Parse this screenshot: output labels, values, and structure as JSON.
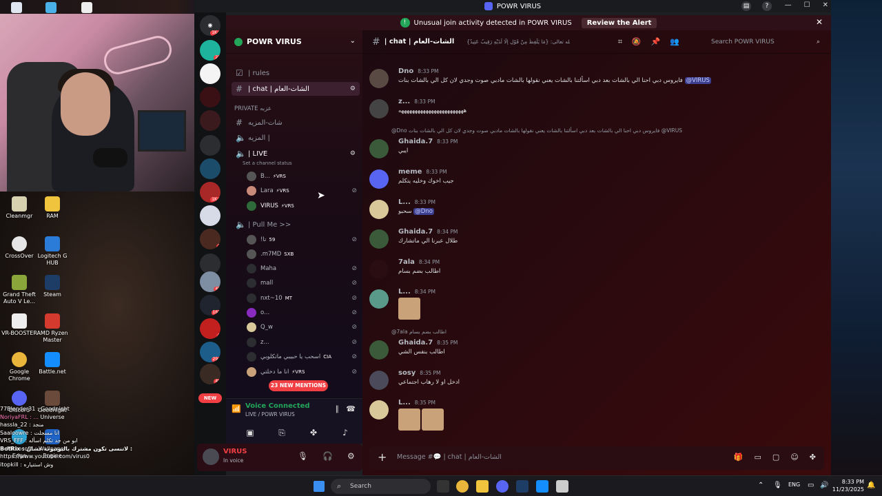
{
  "window": {
    "title": "POWR VIRUS"
  },
  "alert": {
    "text": "Unusual join activity detected in POWR VIRUS",
    "button": "Review the Alert"
  },
  "server": {
    "name": "POWR VIRUS"
  },
  "guild_badges": [
    "1K+",
    "23",
    "1K+",
    "3",
    "49",
    "162",
    "7",
    "294",
    "46"
  ],
  "guild_new": "NEW",
  "channels": {
    "rules": "| rules",
    "chat": "| chat | الشات-العام",
    "private_cat": "PRIVATE عزبه",
    "text_private": "شات-المزيه",
    "voice_private": "المزيه |",
    "live": "| LIVE",
    "live_status": "Set a channel status",
    "pull_me": "| Pull Me >>"
  },
  "voice_users_live": [
    {
      "name": "B...",
      "tag": "⚡VRS"
    },
    {
      "name": "Lara",
      "tag": "⚡VRS"
    },
    {
      "name": "VIRUS",
      "tag": "⚡VRS"
    }
  ],
  "voice_users_pull": [
    {
      "name": "!تا",
      "tag": "59"
    },
    {
      "name": ".m7MD",
      "tag": "SXB"
    },
    {
      "name": "Maha",
      "tag": ""
    },
    {
      "name": "mall",
      "tag": ""
    },
    {
      "name": "nxt~10",
      "tag": "MT"
    },
    {
      "name": "o...",
      "tag": ""
    },
    {
      "name": "Q_w",
      "tag": ""
    },
    {
      "name": "z...",
      "tag": ""
    },
    {
      "name": "اسحب يا حبيبي ماتكلوبي",
      "tag": "CIA"
    },
    {
      "name": "انا ما دخلتي",
      "tag": "⚡VRS"
    }
  ],
  "new_mentions": "23 NEW MENTIONS",
  "voice_panel": {
    "status": "Voice Connected",
    "location": "LIVE / POWR VIRUS"
  },
  "user_panel": {
    "name": "VIRUS",
    "status": "In voice"
  },
  "channel_header": {
    "name": "| chat | الشات-العام",
    "topic": "قال الله تعالى: {مَا يَلْفِظُ مِنْ قَوْلٍ إِلَّا لَدَيْهِ رَقِيبٌ عَتِيدٌ}",
    "search": "Search POWR VIRUS"
  },
  "messages": [
    {
      "name": "Dno",
      "time": "8:33 PM",
      "text": "فايروس دبي احنا الي بالشات بعد دبي اسألتنا بالشات يعني نقولها بالشات مادبي صوت وجدي لان كل الي بالشات بنات",
      "mention": "@VIRUS"
    },
    {
      "name": "z...",
      "time": "8:33 PM",
      "text": "ههههههههههههههههههههههههه"
    },
    {
      "reply": "@Dno فايروس دبي احنا الي بالشات بعد دبي اسألتنا بالشات يعني نقولها بالشات مادبي صوت وجدي لان كل الي بالشات بنات @VIRUS"
    },
    {
      "name": "Ghaida.7",
      "time": "8:33 PM",
      "text": "ايبي"
    },
    {
      "name": "meme",
      "time": "8:33 PM",
      "text": "جيب اخوك وخليه يتكلم"
    },
    {
      "name": "L...",
      "time": "8:33 PM",
      "text": "سحبو",
      "mention": "@Dno"
    },
    {
      "name": "Ghaida.7",
      "time": "8:34 PM",
      "text": "طلال عبرنا الي ماتشارك"
    },
    {
      "name": "7ala",
      "time": "8:34 PM",
      "text": "اطالب بضم بسام"
    },
    {
      "name": "L...",
      "time": "8:34 PM",
      "text": ""
    },
    {
      "reply": "@7ala اطالب بضم بسام"
    },
    {
      "name": "Ghaida.7",
      "time": "8:35 PM",
      "text": "اطالب بنفس الشي"
    },
    {
      "name": "sosy",
      "time": "8:35 PM",
      "text": "ادخل او لا رهاب اجتماعي"
    },
    {
      "name": "L...",
      "time": "8:35 PM",
      "text": ""
    }
  ],
  "composer": {
    "placeholder": "Message #💬 | chat | الشات-العام"
  },
  "desktop_icons": [
    "Cleanmgr",
    "RAM",
    "CrossOver",
    "Logitech G HUB",
    "Grand Theft Auto V Le...",
    "Steam",
    "VR-BOOSTER",
    "AMD Ryzen Master",
    "Google Chrome",
    "Battle.net",
    "Discord",
    "Goodnight Universe",
    "Microsoft Edge",
    "Wallpaper Engine"
  ],
  "chat_overlay": [
    "77Blender31 : Goodnight",
    "NoriyaFRL : ...",
    "hassla_22 : منجد",
    "Saaloowre : انا مسجلت",
    "VRS_FFF : ابو من جد تكلم اسأله",
    "BotRix : لاتنسى تكون مشترك باليوتيوب عشان :",
    "https://www.youtube.com/virus0",
    "itopkill : وش استنياره"
  ],
  "taskbar": {
    "search": "Search",
    "lang": "ENG",
    "time": "8:33 PM",
    "date": "11/23/2025"
  }
}
